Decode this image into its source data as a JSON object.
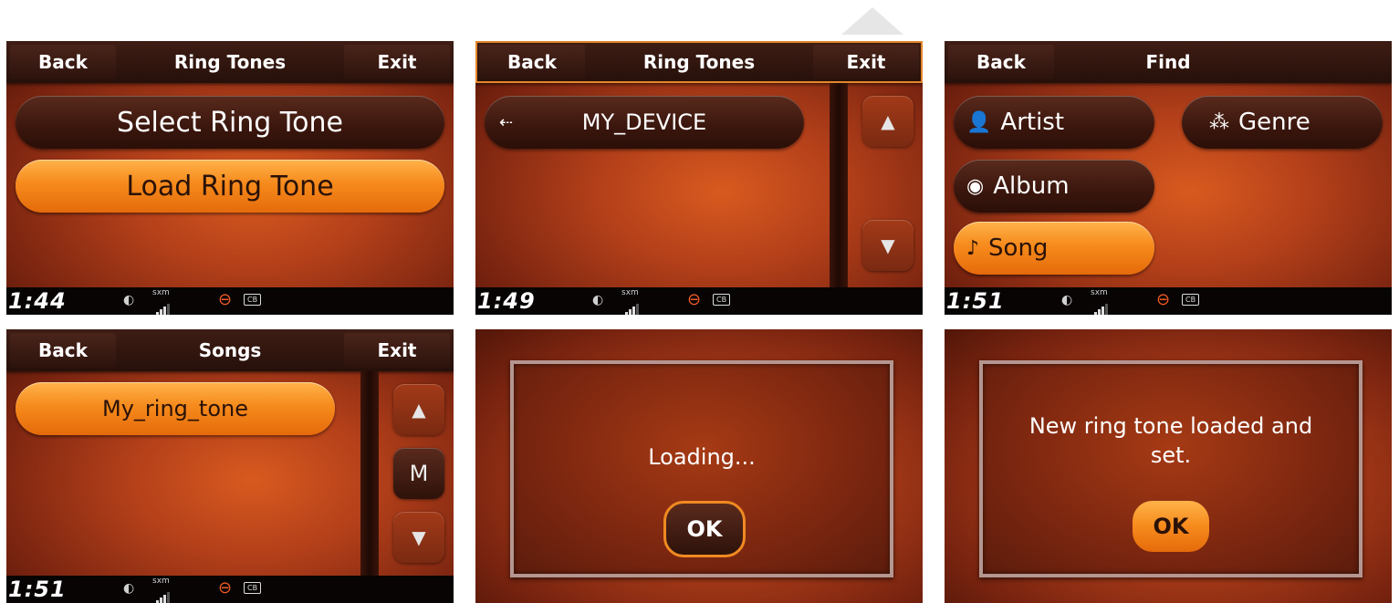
{
  "top_back": "Back",
  "top_exit": "Exit",
  "screens": {
    "s1": {
      "title": "Ring Tones",
      "items": [
        "Select Ring Tone",
        "Load Ring Tone"
      ],
      "time": "1:44"
    },
    "s2": {
      "title": "Ring Tones",
      "device": "MY_DEVICE",
      "time": "1:49"
    },
    "s3": {
      "title": "Find",
      "items": [
        "Artist",
        "Genre",
        "Album",
        "Song"
      ],
      "time": "1:51"
    },
    "s4": {
      "title": "Songs",
      "song": "My_ring_tone",
      "jump": "M",
      "time": "1:51"
    },
    "s5": {
      "message": "Loading...",
      "ok": "OK"
    },
    "s6": {
      "message": "New ring tone loaded and set.",
      "ok": "OK"
    }
  },
  "status": {
    "sxm": "sxm",
    "cb": "CB"
  },
  "colors": {
    "accent": "#f68a1c",
    "background": "#b4401a",
    "bar": "#26100a"
  },
  "icons": [
    "usb-icon",
    "artist-icon",
    "genre-icon",
    "album-icon",
    "note-icon",
    "phone-icon",
    "signal-icon",
    "hd-logo-icon",
    "cb-icon",
    "arrow-up-icon",
    "arrow-down-icon"
  ]
}
